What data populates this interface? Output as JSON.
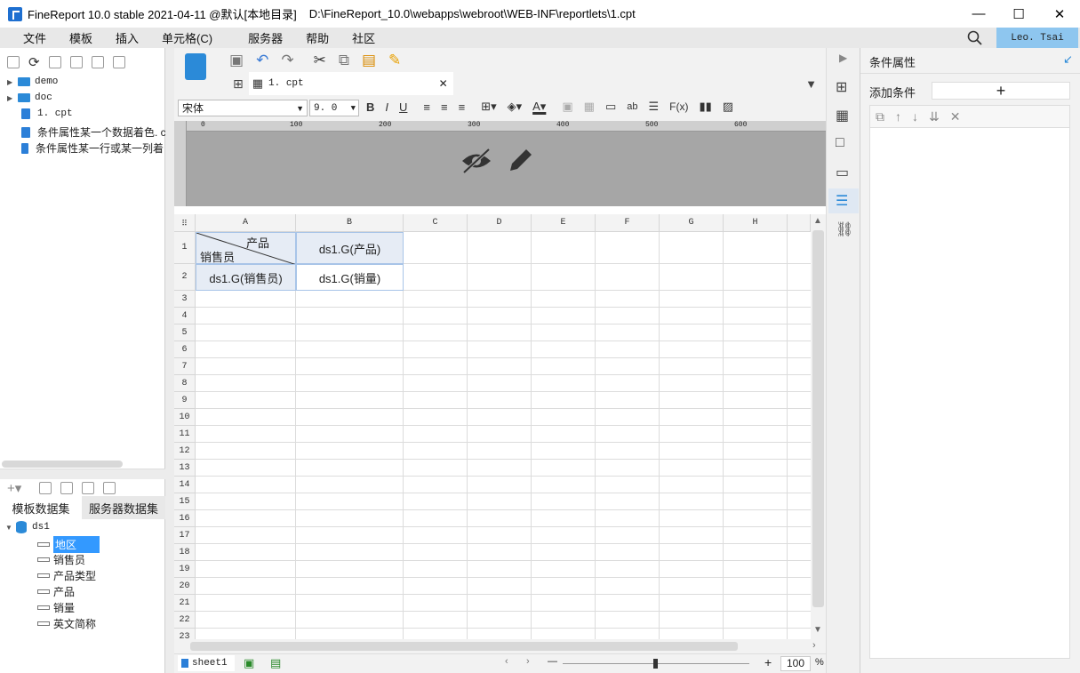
{
  "window": {
    "app_title": "FineReport 10.0 stable 2021-04-11 @默认[本地目录]",
    "file_path": "D:\\FineReport_10.0\\webapps\\webroot\\WEB-INF\\reportlets\\1.cpt",
    "minimize": "—",
    "maximize": "☐",
    "close": "✕"
  },
  "menu": {
    "items": [
      "文件",
      "模板",
      "插入",
      "单元格(C)",
      "服务器",
      "帮助",
      "社区"
    ],
    "user": "Leo. Tsai"
  },
  "file_tree": {
    "items": [
      {
        "label": "demo",
        "type": "folder"
      },
      {
        "label": "doc",
        "type": "folder"
      },
      {
        "label": "1. cpt",
        "type": "file"
      },
      {
        "label": "条件属性某一个数据着色. c",
        "type": "file"
      },
      {
        "label": "条件属性某一行或某一列着",
        "type": "file"
      }
    ]
  },
  "dataset_panel": {
    "tabs": [
      "模板数据集",
      "服务器数据集"
    ],
    "dataset": "ds1",
    "fields": [
      "地区",
      "销售员",
      "产品类型",
      "产品",
      "销量",
      "英文简称"
    ],
    "selected_field": "地区"
  },
  "editor": {
    "tab_label": "1. cpt",
    "font_name": "宋体",
    "font_size": "9. 0",
    "ruler_ticks": [
      "0",
      "100",
      "200",
      "300",
      "400",
      "500",
      "600"
    ]
  },
  "sheet": {
    "columns": [
      "A",
      "B",
      "C",
      "D",
      "E",
      "F",
      "G",
      "H"
    ],
    "rows": [
      "1",
      "2",
      "3",
      "4",
      "5",
      "6",
      "7",
      "8",
      "9",
      "10",
      "11",
      "12",
      "13",
      "14",
      "15",
      "16",
      "17",
      "18",
      "19",
      "20",
      "21",
      "22",
      "23"
    ],
    "cells": {
      "a1_top": "产品",
      "a1_bottom": "销售员",
      "b1": "ds1.G(产品)",
      "a2": "ds1.G(销售员)",
      "b2": "ds1.G(销量)"
    }
  },
  "bottom": {
    "sheet_tab": "sheet1",
    "zoom": "100",
    "zoom_unit": "%",
    "zoom_minus": "—",
    "zoom_plus": "+"
  },
  "right_panel": {
    "title": "条件属性",
    "add_condition": "添加条件",
    "add_button": "+"
  },
  "colors": {
    "accent": "#2b8ad8",
    "user_badge": "#8ec6ef",
    "cell_fill": "#e6ecf5",
    "selection": "#3399ff"
  }
}
